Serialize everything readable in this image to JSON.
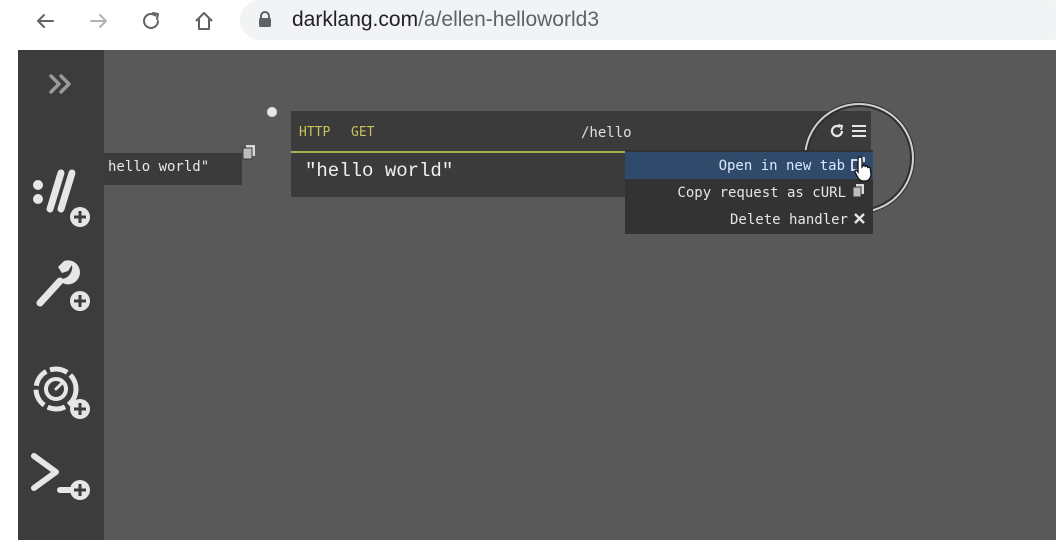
{
  "browser": {
    "url_host": "darklang.com",
    "url_path": "/a/ellen-helloworld3",
    "icons": [
      "back-icon",
      "forward-icon",
      "reload-icon",
      "home-icon",
      "lock-icon"
    ]
  },
  "sidebar": {
    "toggle_icon": "double-chevron-icon",
    "items": [
      {
        "name": "http-handlers",
        "icon": "http-icon"
      },
      {
        "name": "functions",
        "icon": "wrench-icon"
      },
      {
        "name": "cron-workers",
        "icon": "cron-icon"
      },
      {
        "name": "repl",
        "icon": "prompt-icon"
      }
    ]
  },
  "canvas": {
    "fragment_text": "hello world\""
  },
  "handler": {
    "space": "HTTP",
    "method": "GET",
    "path": "/hello",
    "body": "\"hello world\""
  },
  "menu": {
    "items": [
      {
        "label": "Open in new tab",
        "icon": "external-link-icon",
        "active": true
      },
      {
        "label": "Copy request as cURL",
        "icon": "copy-icon",
        "active": false
      },
      {
        "label": "Delete handler",
        "icon": "close-icon",
        "active": false
      }
    ]
  },
  "colors": {
    "canvas_bg": "#595959",
    "sidebar_bg": "#3c3c3c",
    "handler_bg": "#3b3b3b",
    "accent": "#a4b34c",
    "menu_active": "#2f4a6a"
  }
}
